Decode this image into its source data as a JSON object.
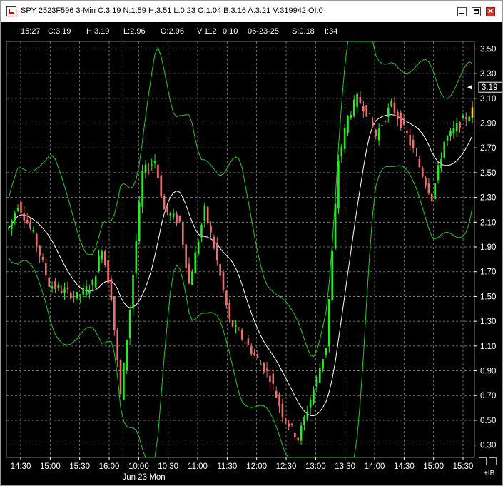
{
  "window": {
    "title": "SPY 2523F596 3-Min C:3.19 N:1.59 H:3.51 L:0.23 O:1.04 B:3.16 A:3.21 V:319942 OI:0",
    "close_glyph": "✕"
  },
  "info": {
    "time": "15:27",
    "close": "C:3.19",
    "high": "H:3.19",
    "low": "L:2.96",
    "open": "O:2.96",
    "volume": "V:112",
    "ratio": "0:10",
    "date": "06-23-25",
    "s": "S:0.18",
    "i": "I:34"
  },
  "footer": {
    "ib_label": "+IB"
  },
  "colors": {
    "up": "#22ee22",
    "down": "#ee6e6e",
    "band": "#22cc22",
    "average": "#ffffff",
    "last_bar": "#ffd400",
    "grid": "#8a8a8a"
  },
  "chart_data": {
    "type": "candlestick",
    "price_label": "3.19",
    "x_labels": [
      "14:30",
      "15:00",
      "15:30",
      "16:00",
      "10:00",
      "10:30",
      "11:00",
      "11:30",
      "12:00",
      "12:30",
      "13:00",
      "13:30",
      "14:00",
      "14:30",
      "15:00",
      "15:30"
    ],
    "date_label": "Jun 23 Mon",
    "y_ticks": [
      "3.50",
      "3.30",
      "3.10",
      "2.90",
      "2.70",
      "2.50",
      "2.30",
      "2.10",
      "1.90",
      "1.70",
      "1.50",
      "1.30",
      "1.10",
      "0.90",
      "0.70",
      "0.50",
      "0.30"
    ],
    "ylim": [
      0.2,
      3.56
    ],
    "bar_count": 150,
    "last_price": 3.19
  }
}
